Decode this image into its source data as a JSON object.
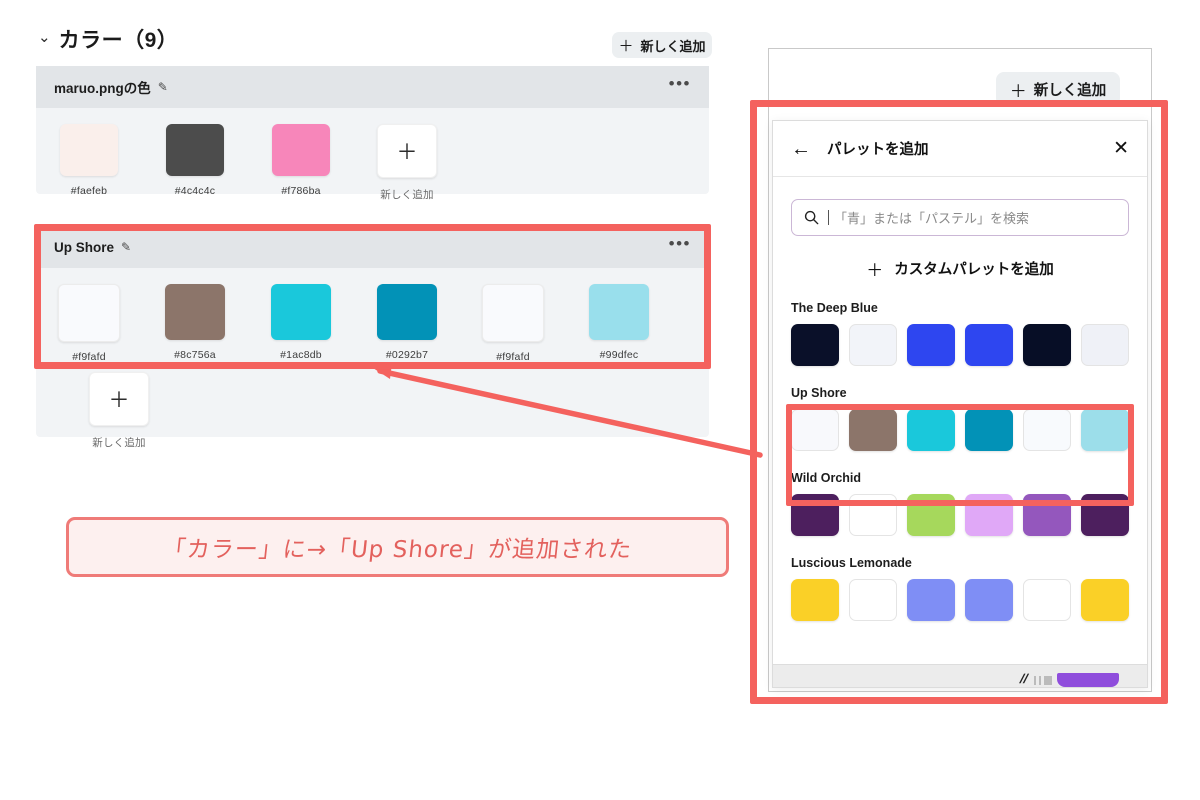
{
  "left_panel": {
    "section": {
      "title": "カラー（9）",
      "chevron": "chevron-down",
      "count": 9
    },
    "add_new_button": {
      "label": "新しく追加",
      "plus": "+"
    },
    "cards": [
      {
        "title": "maruo.pngの色",
        "edit_icon": "pencil",
        "menu_icon": "ellipsis",
        "swatches": [
          {
            "hex": "#faefeb",
            "label": "#faefeb"
          },
          {
            "hex": "#4c4c4c",
            "label": "#4c4c4c"
          },
          {
            "hex": "#f786ba",
            "label": "#f786ba"
          }
        ],
        "add_tile": {
          "plus": "+",
          "label": "新しく追加"
        }
      },
      {
        "title": "Up Shore",
        "edit_icon": "pencil",
        "menu_icon": "ellipsis",
        "swatches": [
          {
            "hex": "#f9fafd",
            "label": "#f9fafd"
          },
          {
            "hex": "#8c756a",
            "label": "#8c756a"
          },
          {
            "hex": "#1ac8db",
            "label": "#1ac8db"
          },
          {
            "hex": "#0292b7",
            "label": "#0292b7"
          },
          {
            "hex": "#f9fafd",
            "label": "#f9fafd"
          },
          {
            "hex": "#99dfec",
            "label": "#99dfec"
          }
        ]
      }
    ],
    "bottom_add_tile": {
      "plus": "+",
      "label": "新しく追加"
    }
  },
  "right_panel": {
    "add_new_button": {
      "label": "新しく追加",
      "plus": "+"
    },
    "modal": {
      "back_icon": "arrow-left",
      "title": "パレットを追加",
      "close_icon": "close-x",
      "search": {
        "placeholder": "「青」または「パステル」を検索",
        "icon": "search-icon"
      },
      "custom_add": {
        "label": "カスタムパレットを追加",
        "plus": "+"
      },
      "palettes": [
        {
          "name": "The Deep Blue",
          "colors": [
            "#0a1029",
            "#f2f4f9",
            "#2e46f0",
            "#2e46f0",
            "#070e26",
            "#eff1f7"
          ]
        },
        {
          "name": "Up Shore",
          "colors": [
            "#f8f9fc",
            "#8c756a",
            "#1ac8db",
            "#0292b7",
            "#f8fafd",
            "#9cdeea"
          ]
        },
        {
          "name": "Wild Orchid",
          "colors": [
            "#4d1f5e",
            "#ffffff",
            "#a6d85c",
            "#e0a8f7",
            "#9457bd",
            "#4d1f5e"
          ]
        },
        {
          "name": "Luscious Lemonade",
          "colors": [
            "#fad027",
            "#ffffff",
            "#7f8ef5",
            "#7f8ef5",
            "#ffffff",
            "#fad027"
          ]
        }
      ]
    }
  },
  "annotation": {
    "note_text": "「カラー」に→「Up Shore」が追加された",
    "highlight_color": "#f4625e"
  }
}
